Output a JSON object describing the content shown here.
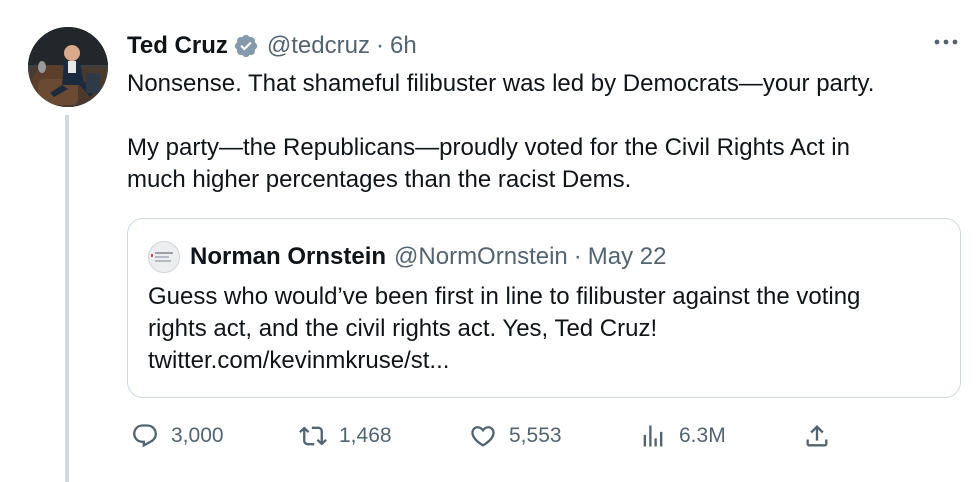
{
  "author": {
    "name": "Ted Cruz",
    "handle": "@tedcruz",
    "separator": "·",
    "time": "6h",
    "verified_icon": "verified-badge-icon"
  },
  "tweet": {
    "paragraphs": [
      "Nonsense. That shameful filibuster was led by Democrats—your party.",
      "My party—the Republicans—proudly voted for the Civil Rights Act in",
      "much higher percentages than the racist Dems."
    ]
  },
  "quote": {
    "name": "Norman Ornstein",
    "handle": "@NormOrnstein",
    "separator": "·",
    "date": "May 22",
    "lines": [
      "Guess who would’ve been first in line to filibuster against the voting",
      "rights act, and the civil rights act. Yes, Ted Cruz!",
      "twitter.com/kevinmkruse/st..."
    ]
  },
  "actions": {
    "replies": "3,000",
    "retweets": "1,468",
    "likes": "5,553",
    "views": "6.3M"
  },
  "colors": {
    "text": "#0f1419",
    "secondary": "#536471",
    "verified": "#829aab",
    "border": "#cfd9de"
  }
}
